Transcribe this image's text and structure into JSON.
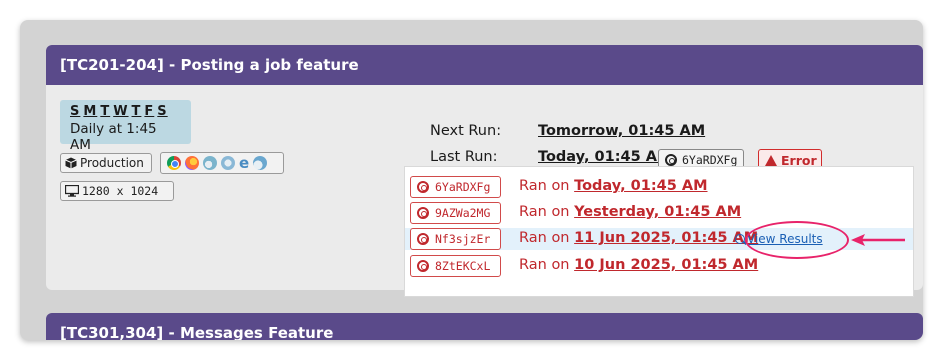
{
  "card1": {
    "title": "[TC201-204] - Posting a job feature",
    "schedule": {
      "days": [
        "S",
        "M",
        "T",
        "W",
        "T",
        "F",
        "S"
      ],
      "text": "Daily at 1:45 AM"
    },
    "environment": "Production",
    "browsers": [
      "chrome-icon",
      "firefox-icon",
      "edge-icon",
      "safari-icon",
      "ie-icon",
      "edge-legacy-icon"
    ],
    "resolution": "1280 x 1024",
    "next_run": {
      "label": "Next Run:",
      "value": "Tomorrow, 01:45 AM"
    },
    "last_run": {
      "label": "Last Run:",
      "value": "Today, 01:45 AM",
      "run_id": "6YaRDXFg",
      "status": "Error"
    },
    "history": [
      {
        "run_id": "6YaRDXFg",
        "prefix": "Ran on",
        "date": "Today, 01:45 AM"
      },
      {
        "run_id": "9AZWa2MG",
        "prefix": "Ran on",
        "date": "Yesterday, 01:45 AM"
      },
      {
        "run_id": "Nf3sjzEr",
        "prefix": "Ran on",
        "date": "11 Jun 2025, 01:45 AM",
        "action": "View Results"
      },
      {
        "run_id": "8ZtEKCxL",
        "prefix": "Ran on",
        "date": "10 Jun 2025, 01:45 AM"
      }
    ]
  },
  "card2": {
    "title": "[TC301,304] - Messages Feature"
  },
  "colors": {
    "header": "#5a4a8a",
    "error": "#c0282d",
    "highlight": "#e3f1fb",
    "annotation": "#e8236a",
    "link": "#1a5fb4"
  }
}
